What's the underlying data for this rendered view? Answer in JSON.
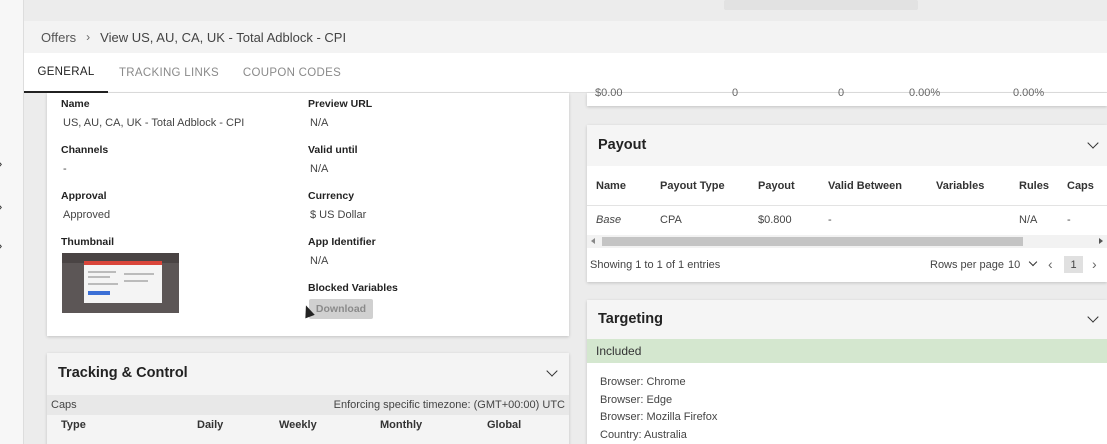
{
  "breadcrumb": {
    "root": "Offers",
    "current": "View US, AU, CA, UK - Total Adblock - CPI"
  },
  "tabs": [
    {
      "label": "GENERAL",
      "active": true
    },
    {
      "label": "TRACKING LINKS",
      "active": false
    },
    {
      "label": "COUPON CODES",
      "active": false
    }
  ],
  "general": {
    "name_label": "Name",
    "name_value": "US, AU, CA, UK - Total Adblock - CPI",
    "channels_label": "Channels",
    "channels_value": "-",
    "approval_label": "Approval",
    "approval_value": "Approved",
    "thumbnail_label": "Thumbnail",
    "preview_label": "Preview URL",
    "preview_value": "N/A",
    "valid_label": "Valid until",
    "valid_value": "N/A",
    "currency_label": "Currency",
    "currency_value": "$ US Dollar",
    "appid_label": "App Identifier",
    "appid_value": "N/A",
    "blocked_label": "Blocked Variables",
    "download_label": "Download"
  },
  "tracking": {
    "title": "Tracking & Control",
    "caps_label": "Caps",
    "timezone_text": "Enforcing specific timezone: (GMT+00:00) UTC",
    "columns": [
      "Type",
      "Daily",
      "Weekly",
      "Monthly",
      "Global"
    ]
  },
  "stats_row": [
    "$0.00",
    "0",
    "0",
    "0.00%",
    "0.00%"
  ],
  "payout": {
    "title": "Payout",
    "columns": [
      "Name",
      "Payout Type",
      "Payout",
      "Valid Between",
      "Variables",
      "Rules",
      "Caps"
    ],
    "row": [
      "Base",
      "CPA",
      "$0.800",
      "-",
      "",
      "N/A",
      "-"
    ],
    "showing_text": "Showing 1 to 1 of 1 entries",
    "rows_per_page_label": "Rows per page",
    "rows_per_page_value": "10",
    "page": "1"
  },
  "targeting": {
    "title": "Targeting",
    "included_label": "Included",
    "items": [
      "Browser: Chrome",
      "Browser: Edge",
      "Browser: Mozilla Firefox",
      "Country: Australia"
    ]
  },
  "colors": {
    "included_bg": "#d4e7cf",
    "active_tab": "#222222",
    "muted_tab": "#8a8a8a"
  }
}
